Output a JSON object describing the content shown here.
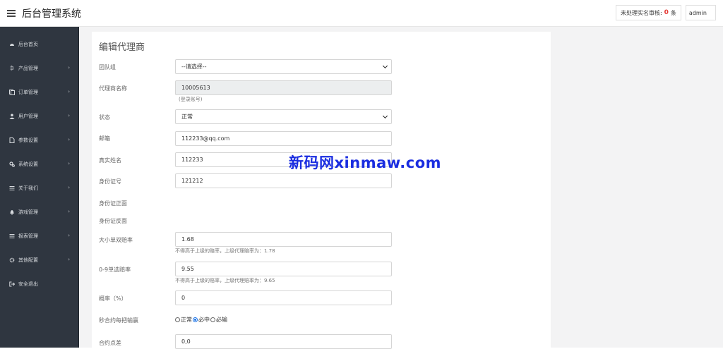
{
  "header": {
    "title": "后台管理系统",
    "pending_label": "未处理实名审核:",
    "pending_count": "0",
    "pending_unit": "条",
    "user": "admin"
  },
  "sidebar": {
    "items": [
      {
        "label": "后台首页",
        "icon": "dashboard-icon",
        "has_arrow": false
      },
      {
        "label": "产品管理",
        "icon": "bitcoin-icon",
        "has_arrow": true
      },
      {
        "label": "订单管理",
        "icon": "copy-icon",
        "has_arrow": true
      },
      {
        "label": "用户管理",
        "icon": "user-icon",
        "has_arrow": true
      },
      {
        "label": "参数设置",
        "icon": "file-icon",
        "has_arrow": true
      },
      {
        "label": "系统设置",
        "icon": "gears-icon",
        "has_arrow": true
      },
      {
        "label": "关于我们",
        "icon": "list-icon",
        "has_arrow": true
      },
      {
        "label": "游戏管理",
        "icon": "bell-icon",
        "has_arrow": true
      },
      {
        "label": "报表管理",
        "icon": "list-icon",
        "has_arrow": true
      },
      {
        "label": "其他配置",
        "icon": "gear-icon",
        "has_arrow": true
      },
      {
        "label": "安全退出",
        "icon": "sign-out-icon",
        "has_arrow": false
      }
    ]
  },
  "form": {
    "title": "编辑代理商",
    "team_group": {
      "label": "团队组",
      "value": "--请选择--"
    },
    "agent_name": {
      "label": "代理商名称",
      "value": "10005613",
      "hint": "(登录账号)"
    },
    "status": {
      "label": "状态",
      "value": "正常"
    },
    "email": {
      "label": "邮箱",
      "value": "112233@qq.com"
    },
    "real_name": {
      "label": "真实姓名",
      "value": "112233"
    },
    "id_number": {
      "label": "身份证号",
      "value": "121212"
    },
    "id_front": {
      "label": "身份证正面"
    },
    "id_back": {
      "label": "身份证反面"
    },
    "odds_big_small": {
      "label": "大小单双赔率",
      "value": "1.68",
      "hint": "不得高于上级的赔率，上级代理赔率为：1.78"
    },
    "odds_0_9": {
      "label": "0-9单选赔率",
      "value": "9.55",
      "hint": "不得高于上级的赔率，上级代理赔率为：9.65"
    },
    "probability": {
      "label": "概率（%）",
      "value": "0"
    },
    "contract_result": {
      "label": "秒合约每把输赢",
      "options": [
        "正常",
        "必中",
        "必输"
      ],
      "selected": "必中"
    },
    "contract_spread": {
      "label": "合约点差",
      "value": "0,0"
    }
  },
  "watermark": "新码网xinmaw.com"
}
